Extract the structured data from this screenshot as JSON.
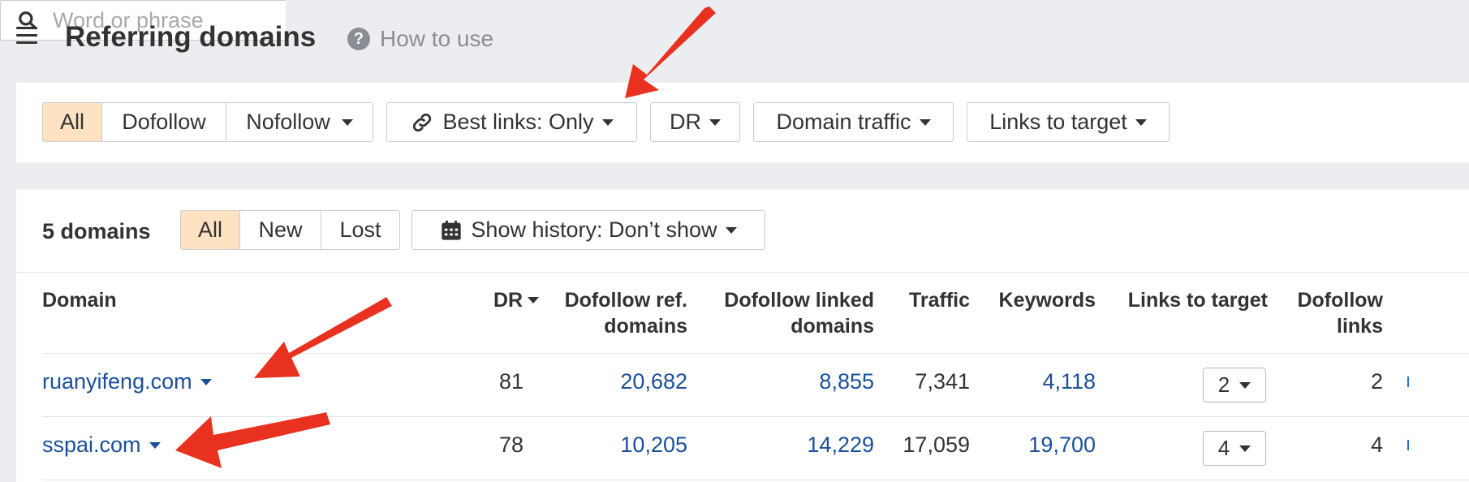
{
  "header": {
    "title": "Referring domains",
    "help_label": "How to use"
  },
  "filters": {
    "link_types": [
      "All",
      "Dofollow",
      "Nofollow"
    ],
    "best_links": "Best links: Only",
    "dr": "DR",
    "domain_traffic": "Domain traffic",
    "links_to_target": "Links to target",
    "search_placeholder": "Word or phrase"
  },
  "table_toolbar": {
    "count": "5 domains",
    "status_tabs": [
      "All",
      "New",
      "Lost"
    ],
    "history": "Show history: Don’t show"
  },
  "columns": {
    "domain": "Domain",
    "dr": "DR",
    "dofollow_ref_domains": [
      "Dofollow ref.",
      "domains"
    ],
    "dofollow_linked_domains": [
      "Dofollow linked",
      "domains"
    ],
    "traffic": "Traffic",
    "keywords": "Keywords",
    "links_to_target": "Links to target",
    "dofollow_links": [
      "Dofollow",
      "links"
    ]
  },
  "rows": [
    {
      "domain": "ruanyifeng.com",
      "dr": "81",
      "dofollow_ref_domains": "20,682",
      "dofollow_linked_domains": "8,855",
      "traffic": "7,341",
      "keywords": "4,118",
      "links_to_target": "2",
      "dofollow_links": "2"
    },
    {
      "domain": "sspai.com",
      "dr": "78",
      "dofollow_ref_domains": "10,205",
      "dofollow_linked_domains": "14,229",
      "traffic": "17,059",
      "keywords": "19,700",
      "links_to_target": "4",
      "dofollow_links": "4"
    }
  ],
  "colors": {
    "link": "#1a4f9c",
    "active_segment": "#fde3c2",
    "annotation_arrow": "#e8321f"
  }
}
